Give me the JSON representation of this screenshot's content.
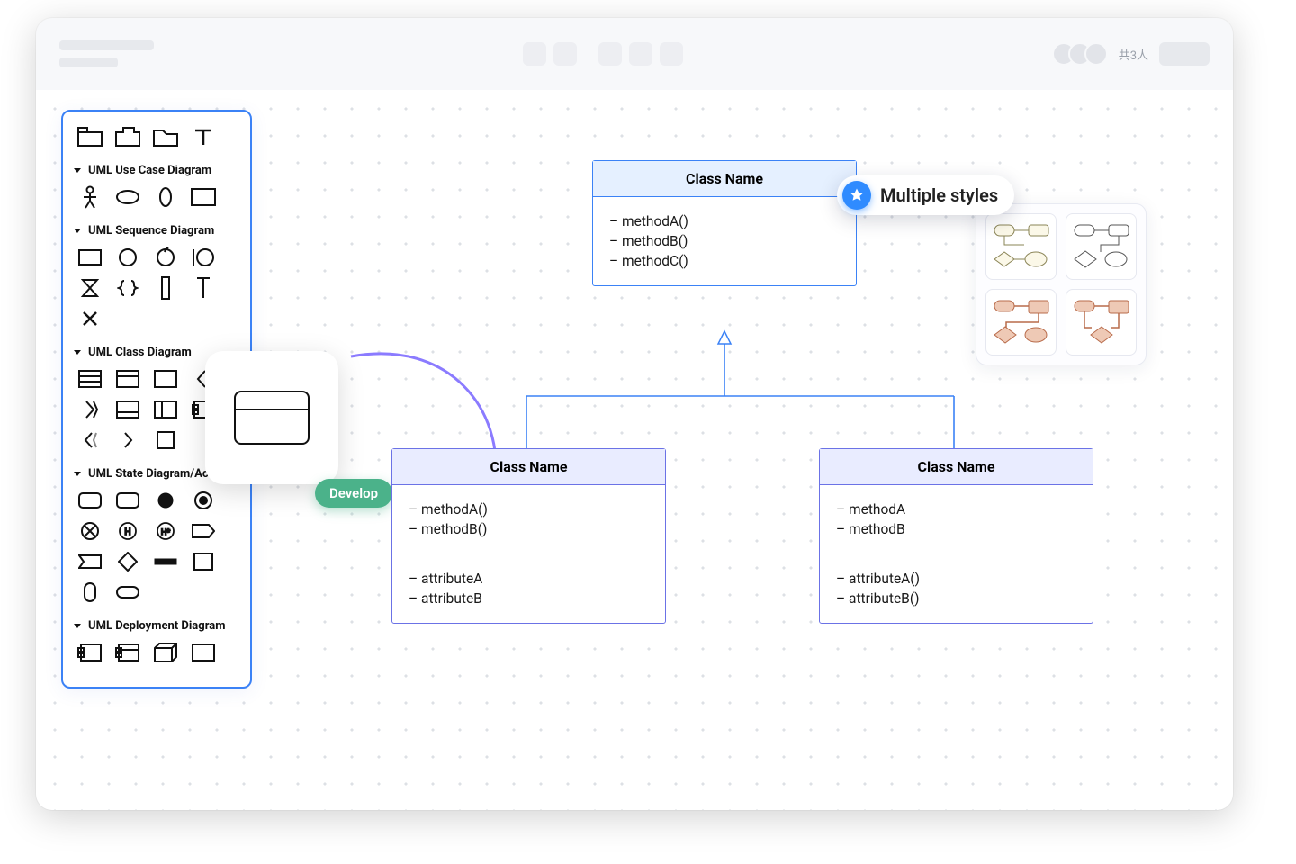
{
  "topbar": {
    "collaborator_label": "共3人"
  },
  "sidebar": {
    "sections": [
      {
        "label": "UML Use Case Diagram"
      },
      {
        "label": "UML Sequence Diagram"
      },
      {
        "label": "UML Class Diagram"
      },
      {
        "label": "UML State Diagram/Activ..."
      },
      {
        "label": "UML Deployment Diagram"
      }
    ]
  },
  "drag": {
    "badge": "Develop"
  },
  "styles": {
    "badge_label": "Multiple styles"
  },
  "uml": {
    "top": {
      "title": "Class Name",
      "methods": [
        "methodA()",
        "methodB()",
        "methodC()"
      ]
    },
    "left": {
      "title": "Class Name",
      "methods": [
        "methodA()",
        "methodB()"
      ],
      "attributes": [
        "attributeA",
        "attributeB"
      ]
    },
    "right": {
      "title": "Class Name",
      "methods": [
        "methodA",
        "methodB"
      ],
      "attributes": [
        "attributeA()",
        "attributeB()"
      ]
    }
  }
}
